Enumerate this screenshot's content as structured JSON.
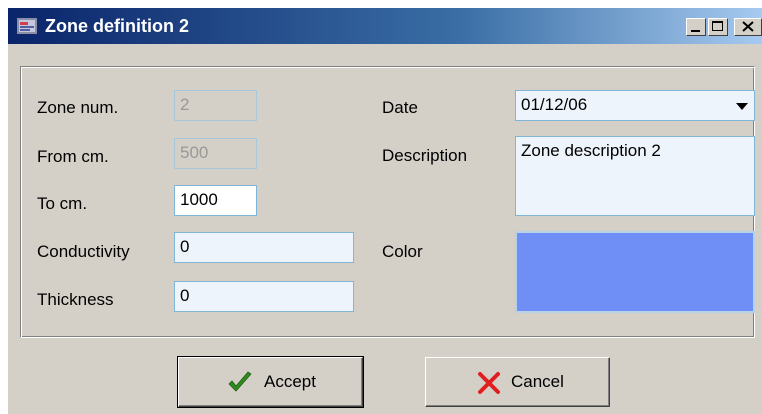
{
  "window": {
    "title": "Zone definition 2",
    "minimize_glyph": "_",
    "maximize_glyph": "□",
    "close_glyph": "✕"
  },
  "form": {
    "zone_num": {
      "label": "Zone num.",
      "value": "2"
    },
    "from_cm": {
      "label": "From cm.",
      "value": "500"
    },
    "to_cm": {
      "label": "To cm.",
      "value": "1000"
    },
    "conductivity": {
      "label": "Conductivity",
      "value": "0"
    },
    "thickness": {
      "label": "Thickness",
      "value": "0"
    },
    "date": {
      "label": "Date",
      "value": "01/12/06"
    },
    "description": {
      "label": "Description",
      "value": "Zone description 2"
    },
    "color": {
      "label": "Color",
      "swatch": "#6f8ff7"
    }
  },
  "buttons": {
    "accept": {
      "label": "Accept",
      "icon": "checkmark-icon",
      "icon_color": "#2e8b1e"
    },
    "cancel": {
      "label": "Cancel",
      "icon": "x-mark-icon",
      "icon_color": "#e02020"
    }
  },
  "colors": {
    "titlebar_start": "#0a246a",
    "window_bg": "#d4d0c8",
    "field_border": "#7fb6d8"
  }
}
